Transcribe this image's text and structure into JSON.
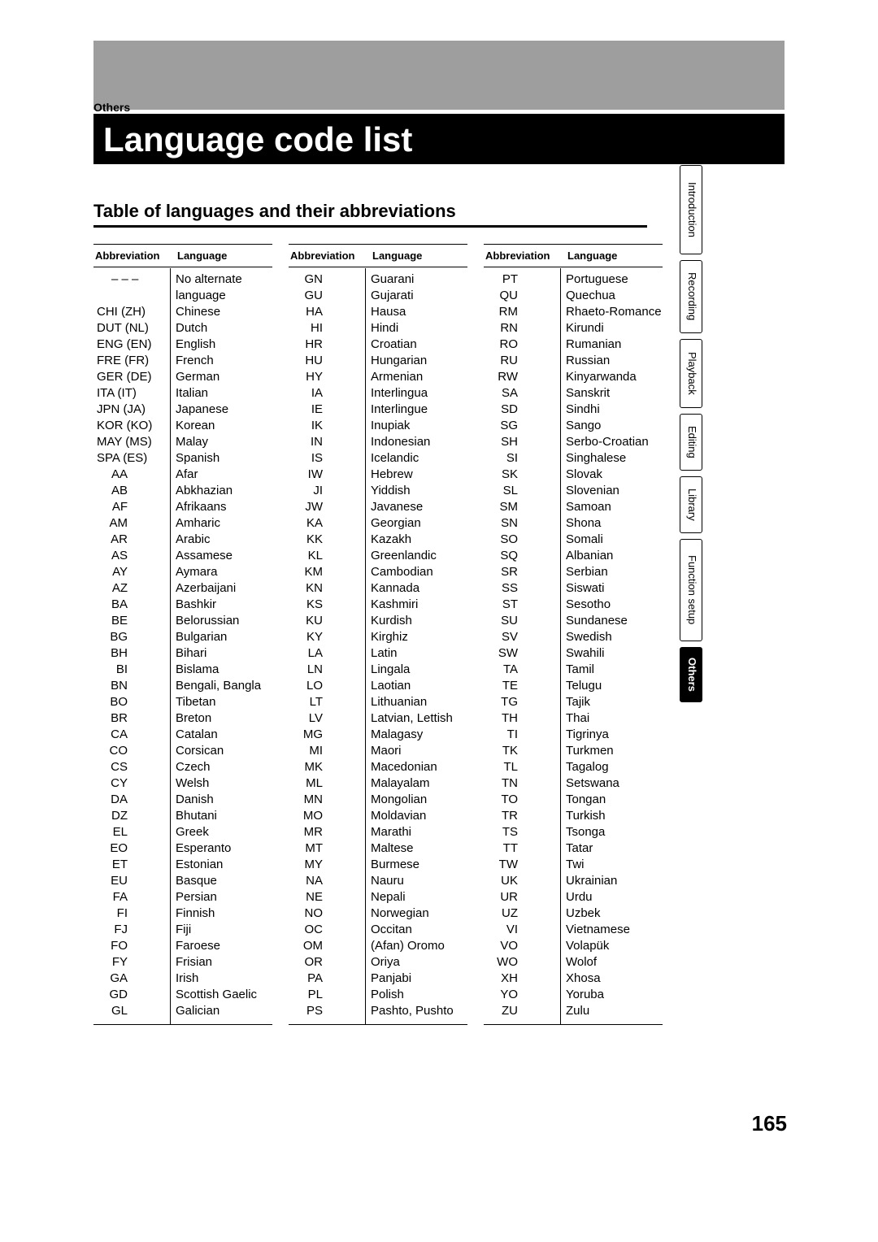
{
  "breadcrumb": "Others",
  "title": "Language code list",
  "subtitle": "Table of languages and their abbreviations",
  "page_number": "165",
  "headers": {
    "abbrev": "Abbreviation",
    "lang": "Language"
  },
  "tabs": [
    "Introduction",
    "Recording",
    "Playback",
    "Editing",
    "Library",
    "Function setup",
    "Others"
  ],
  "col1": [
    {
      "a": "– – –",
      "l": "No alternate",
      "pad": true
    },
    {
      "a": "",
      "l": "language",
      "pad": true
    },
    {
      "a": "CHI (ZH)",
      "l": "Chinese"
    },
    {
      "a": "DUT (NL)",
      "l": "Dutch"
    },
    {
      "a": "ENG (EN)",
      "l": "English"
    },
    {
      "a": "FRE (FR)",
      "l": "French"
    },
    {
      "a": "GER (DE)",
      "l": "German"
    },
    {
      "a": "ITA (IT)",
      "l": "Italian"
    },
    {
      "a": "JPN (JA)",
      "l": "Japanese"
    },
    {
      "a": "KOR (KO)",
      "l": "Korean"
    },
    {
      "a": "MAY (MS)",
      "l": "Malay"
    },
    {
      "a": "SPA (ES)",
      "l": "Spanish"
    },
    {
      "a": "AA",
      "l": "Afar",
      "s": true
    },
    {
      "a": "AB",
      "l": "Abkhazian",
      "s": true
    },
    {
      "a": "AF",
      "l": "Afrikaans",
      "s": true
    },
    {
      "a": "AM",
      "l": "Amharic",
      "s": true
    },
    {
      "a": "AR",
      "l": "Arabic",
      "s": true
    },
    {
      "a": "AS",
      "l": "Assamese",
      "s": true
    },
    {
      "a": "AY",
      "l": "Aymara",
      "s": true
    },
    {
      "a": "AZ",
      "l": "Azerbaijani",
      "s": true
    },
    {
      "a": "BA",
      "l": "Bashkir",
      "s": true
    },
    {
      "a": "BE",
      "l": "Belorussian",
      "s": true
    },
    {
      "a": "BG",
      "l": "Bulgarian",
      "s": true
    },
    {
      "a": "BH",
      "l": "Bihari",
      "s": true
    },
    {
      "a": "BI",
      "l": "Bislama",
      "s": true
    },
    {
      "a": "BN",
      "l": "Bengali, Bangla",
      "s": true
    },
    {
      "a": "BO",
      "l": "Tibetan",
      "s": true
    },
    {
      "a": "BR",
      "l": "Breton",
      "s": true
    },
    {
      "a": "CA",
      "l": "Catalan",
      "s": true
    },
    {
      "a": "CO",
      "l": "Corsican",
      "s": true
    },
    {
      "a": "CS",
      "l": "Czech",
      "s": true
    },
    {
      "a": "CY",
      "l": "Welsh",
      "s": true
    },
    {
      "a": "DA",
      "l": "Danish",
      "s": true
    },
    {
      "a": "DZ",
      "l": "Bhutani",
      "s": true
    },
    {
      "a": "EL",
      "l": "Greek",
      "s": true
    },
    {
      "a": "EO",
      "l": "Esperanto",
      "s": true
    },
    {
      "a": "ET",
      "l": "Estonian",
      "s": true
    },
    {
      "a": "EU",
      "l": "Basque",
      "s": true
    },
    {
      "a": "FA",
      "l": "Persian",
      "s": true
    },
    {
      "a": "FI",
      "l": "Finnish",
      "s": true
    },
    {
      "a": "FJ",
      "l": "Fiji",
      "s": true
    },
    {
      "a": "FO",
      "l": "Faroese",
      "s": true
    },
    {
      "a": "FY",
      "l": "Frisian",
      "s": true
    },
    {
      "a": "GA",
      "l": "Irish",
      "s": true
    },
    {
      "a": "GD",
      "l": "Scottish Gaelic",
      "s": true
    },
    {
      "a": "GL",
      "l": "Galician",
      "s": true
    }
  ],
  "col2": [
    {
      "a": "GN",
      "l": "Guarani",
      "s": true
    },
    {
      "a": "GU",
      "l": "Gujarati",
      "s": true
    },
    {
      "a": "HA",
      "l": "Hausa",
      "s": true
    },
    {
      "a": "HI",
      "l": "Hindi",
      "s": true
    },
    {
      "a": "HR",
      "l": "Croatian",
      "s": true
    },
    {
      "a": "HU",
      "l": "Hungarian",
      "s": true
    },
    {
      "a": "HY",
      "l": "Armenian",
      "s": true
    },
    {
      "a": "IA",
      "l": "Interlingua",
      "s": true
    },
    {
      "a": "IE",
      "l": "Interlingue",
      "s": true
    },
    {
      "a": "IK",
      "l": "Inupiak",
      "s": true
    },
    {
      "a": "IN",
      "l": "Indonesian",
      "s": true
    },
    {
      "a": "IS",
      "l": "Icelandic",
      "s": true
    },
    {
      "a": "IW",
      "l": "Hebrew",
      "s": true
    },
    {
      "a": "JI",
      "l": "Yiddish",
      "s": true
    },
    {
      "a": "JW",
      "l": "Javanese",
      "s": true
    },
    {
      "a": "KA",
      "l": "Georgian",
      "s": true
    },
    {
      "a": "KK",
      "l": "Kazakh",
      "s": true
    },
    {
      "a": "KL",
      "l": "Greenlandic",
      "s": true
    },
    {
      "a": "KM",
      "l": "Cambodian",
      "s": true
    },
    {
      "a": "KN",
      "l": "Kannada",
      "s": true
    },
    {
      "a": "KS",
      "l": "Kashmiri",
      "s": true
    },
    {
      "a": "KU",
      "l": "Kurdish",
      "s": true
    },
    {
      "a": "KY",
      "l": "Kirghiz",
      "s": true
    },
    {
      "a": "LA",
      "l": "Latin",
      "s": true
    },
    {
      "a": "LN",
      "l": "Lingala",
      "s": true
    },
    {
      "a": "LO",
      "l": "Laotian",
      "s": true
    },
    {
      "a": "LT",
      "l": "Lithuanian",
      "s": true
    },
    {
      "a": "LV",
      "l": "Latvian, Lettish",
      "s": true
    },
    {
      "a": "MG",
      "l": "Malagasy",
      "s": true
    },
    {
      "a": "MI",
      "l": "Maori",
      "s": true
    },
    {
      "a": "MK",
      "l": "Macedonian",
      "s": true
    },
    {
      "a": "ML",
      "l": "Malayalam",
      "s": true
    },
    {
      "a": "MN",
      "l": "Mongolian",
      "s": true
    },
    {
      "a": "MO",
      "l": "Moldavian",
      "s": true
    },
    {
      "a": "MR",
      "l": "Marathi",
      "s": true
    },
    {
      "a": "MT",
      "l": "Maltese",
      "s": true
    },
    {
      "a": "MY",
      "l": "Burmese",
      "s": true
    },
    {
      "a": "NA",
      "l": "Nauru",
      "s": true
    },
    {
      "a": "NE",
      "l": "Nepali",
      "s": true
    },
    {
      "a": "NO",
      "l": "Norwegian",
      "s": true
    },
    {
      "a": "OC",
      "l": "Occitan",
      "s": true
    },
    {
      "a": "OM",
      "l": "(Afan) Oromo",
      "s": true
    },
    {
      "a": "OR",
      "l": "Oriya",
      "s": true
    },
    {
      "a": "PA",
      "l": "Panjabi",
      "s": true
    },
    {
      "a": "PL",
      "l": "Polish",
      "s": true
    },
    {
      "a": "PS",
      "l": "Pashto, Pushto",
      "s": true
    }
  ],
  "col3": [
    {
      "a": "PT",
      "l": "Portuguese",
      "s": true
    },
    {
      "a": "QU",
      "l": "Quechua",
      "s": true
    },
    {
      "a": "RM",
      "l": "Rhaeto-Romance",
      "s": true
    },
    {
      "a": "RN",
      "l": "Kirundi",
      "s": true
    },
    {
      "a": "RO",
      "l": "Rumanian",
      "s": true
    },
    {
      "a": "RU",
      "l": "Russian",
      "s": true
    },
    {
      "a": "RW",
      "l": "Kinyarwanda",
      "s": true
    },
    {
      "a": "SA",
      "l": "Sanskrit",
      "s": true
    },
    {
      "a": "SD",
      "l": "Sindhi",
      "s": true
    },
    {
      "a": "SG",
      "l": "Sango",
      "s": true
    },
    {
      "a": "SH",
      "l": "Serbo-Croatian",
      "s": true
    },
    {
      "a": "SI",
      "l": "Singhalese",
      "s": true
    },
    {
      "a": "SK",
      "l": "Slovak",
      "s": true
    },
    {
      "a": "SL",
      "l": "Slovenian",
      "s": true
    },
    {
      "a": "SM",
      "l": "Samoan",
      "s": true
    },
    {
      "a": "SN",
      "l": "Shona",
      "s": true
    },
    {
      "a": "SO",
      "l": "Somali",
      "s": true
    },
    {
      "a": "SQ",
      "l": "Albanian",
      "s": true
    },
    {
      "a": "SR",
      "l": "Serbian",
      "s": true
    },
    {
      "a": "SS",
      "l": "Siswati",
      "s": true
    },
    {
      "a": "ST",
      "l": "Sesotho",
      "s": true
    },
    {
      "a": "SU",
      "l": "Sundanese",
      "s": true
    },
    {
      "a": "SV",
      "l": "Swedish",
      "s": true
    },
    {
      "a": "SW",
      "l": "Swahili",
      "s": true
    },
    {
      "a": "TA",
      "l": "Tamil",
      "s": true
    },
    {
      "a": "TE",
      "l": "Telugu",
      "s": true
    },
    {
      "a": "TG",
      "l": "Tajik",
      "s": true
    },
    {
      "a": "TH",
      "l": "Thai",
      "s": true
    },
    {
      "a": "TI",
      "l": "Tigrinya",
      "s": true
    },
    {
      "a": "TK",
      "l": "Turkmen",
      "s": true
    },
    {
      "a": "TL",
      "l": "Tagalog",
      "s": true
    },
    {
      "a": "TN",
      "l": "Setswana",
      "s": true
    },
    {
      "a": "TO",
      "l": "Tongan",
      "s": true
    },
    {
      "a": "TR",
      "l": "Turkish",
      "s": true
    },
    {
      "a": "TS",
      "l": "Tsonga",
      "s": true
    },
    {
      "a": "TT",
      "l": "Tatar",
      "s": true
    },
    {
      "a": "TW",
      "l": "Twi",
      "s": true
    },
    {
      "a": "UK",
      "l": "Ukrainian",
      "s": true
    },
    {
      "a": "UR",
      "l": "Urdu",
      "s": true
    },
    {
      "a": "UZ",
      "l": "Uzbek",
      "s": true
    },
    {
      "a": "VI",
      "l": "Vietnamese",
      "s": true
    },
    {
      "a": "VO",
      "l": "Volapük",
      "s": true
    },
    {
      "a": "WO",
      "l": "Wolof",
      "s": true
    },
    {
      "a": "XH",
      "l": "Xhosa",
      "s": true
    },
    {
      "a": "YO",
      "l": "Yoruba",
      "s": true
    },
    {
      "a": "ZU",
      "l": "Zulu",
      "s": true
    }
  ]
}
